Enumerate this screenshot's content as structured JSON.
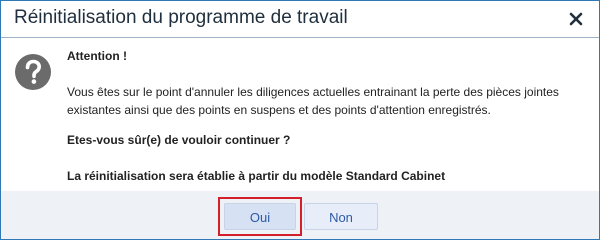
{
  "dialog": {
    "title": "Réinitialisation du programme de travail",
    "close_icon": "close-icon",
    "message_icon": "question-icon",
    "heading": "Attention !",
    "paragraphs": [
      "Vous êtes sur le point d'annuler les diligences actuelles entrainant la perte des pièces jointes existantes ainsi que des points en suspens et des points d'attention enregistrés.",
      "Etes-vous sûr(e) de vouloir continuer ?",
      "La réinitialisation sera établie à partir du modèle Standard Cabinet"
    ]
  },
  "buttons": {
    "yes_label": "Oui",
    "no_label": "Non"
  },
  "colors": {
    "border": "#2f79b7",
    "icon": "#6b6b6b",
    "footer_bg": "#eef1f6",
    "button_text": "#2d5aa8",
    "highlight": "#d21f2b"
  }
}
